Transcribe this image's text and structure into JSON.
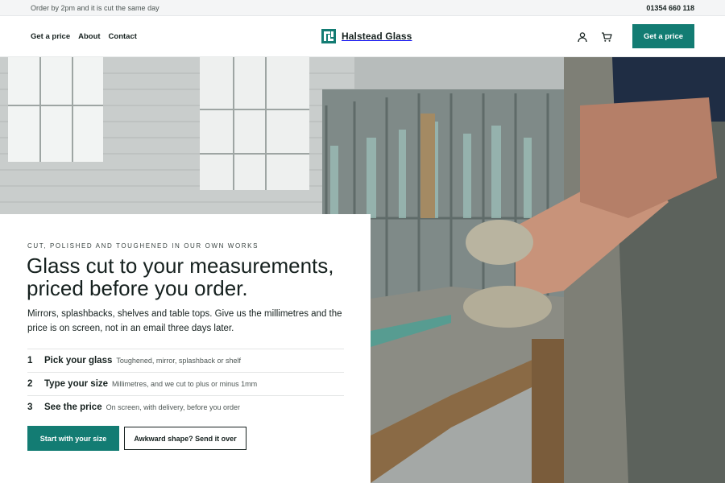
{
  "announcement": {
    "message": "Order by 2pm and it is cut the same day",
    "phone": "01354 660 118"
  },
  "header": {
    "nav": [
      "Get a price",
      "About",
      "Contact"
    ],
    "brand_name": "Halstead Glass",
    "account_icon": "user-icon",
    "cart_icon": "cart-icon",
    "cta_label": "Get a price"
  },
  "hero": {
    "image": "photo-of-worker-cutting-glass-in-workshop",
    "eyebrow": "CUT, POLISHED AND TOUGHENED IN OUR OWN WORKS",
    "headline": "Glass cut to your measurements, priced before you order.",
    "lede": "Mirrors, splashbacks, shelves and table tops. Give us the millimetres and the price is on screen, not in an email three days later.",
    "steps": [
      {
        "number": "1",
        "title": "Pick your glass",
        "description": "Toughened, mirror, splashback or shelf"
      },
      {
        "number": "2",
        "title": "Type your size",
        "description": "Millimetres, and we cut to plus or minus 1mm"
      },
      {
        "number": "3",
        "title": "See the price",
        "description": "On screen, with delivery, before you order"
      }
    ],
    "primary_button": "Start with your size",
    "secondary_button": "Awkward shape? Send it over"
  },
  "colors": {
    "accent": "#137c73",
    "text": "#16211f"
  }
}
